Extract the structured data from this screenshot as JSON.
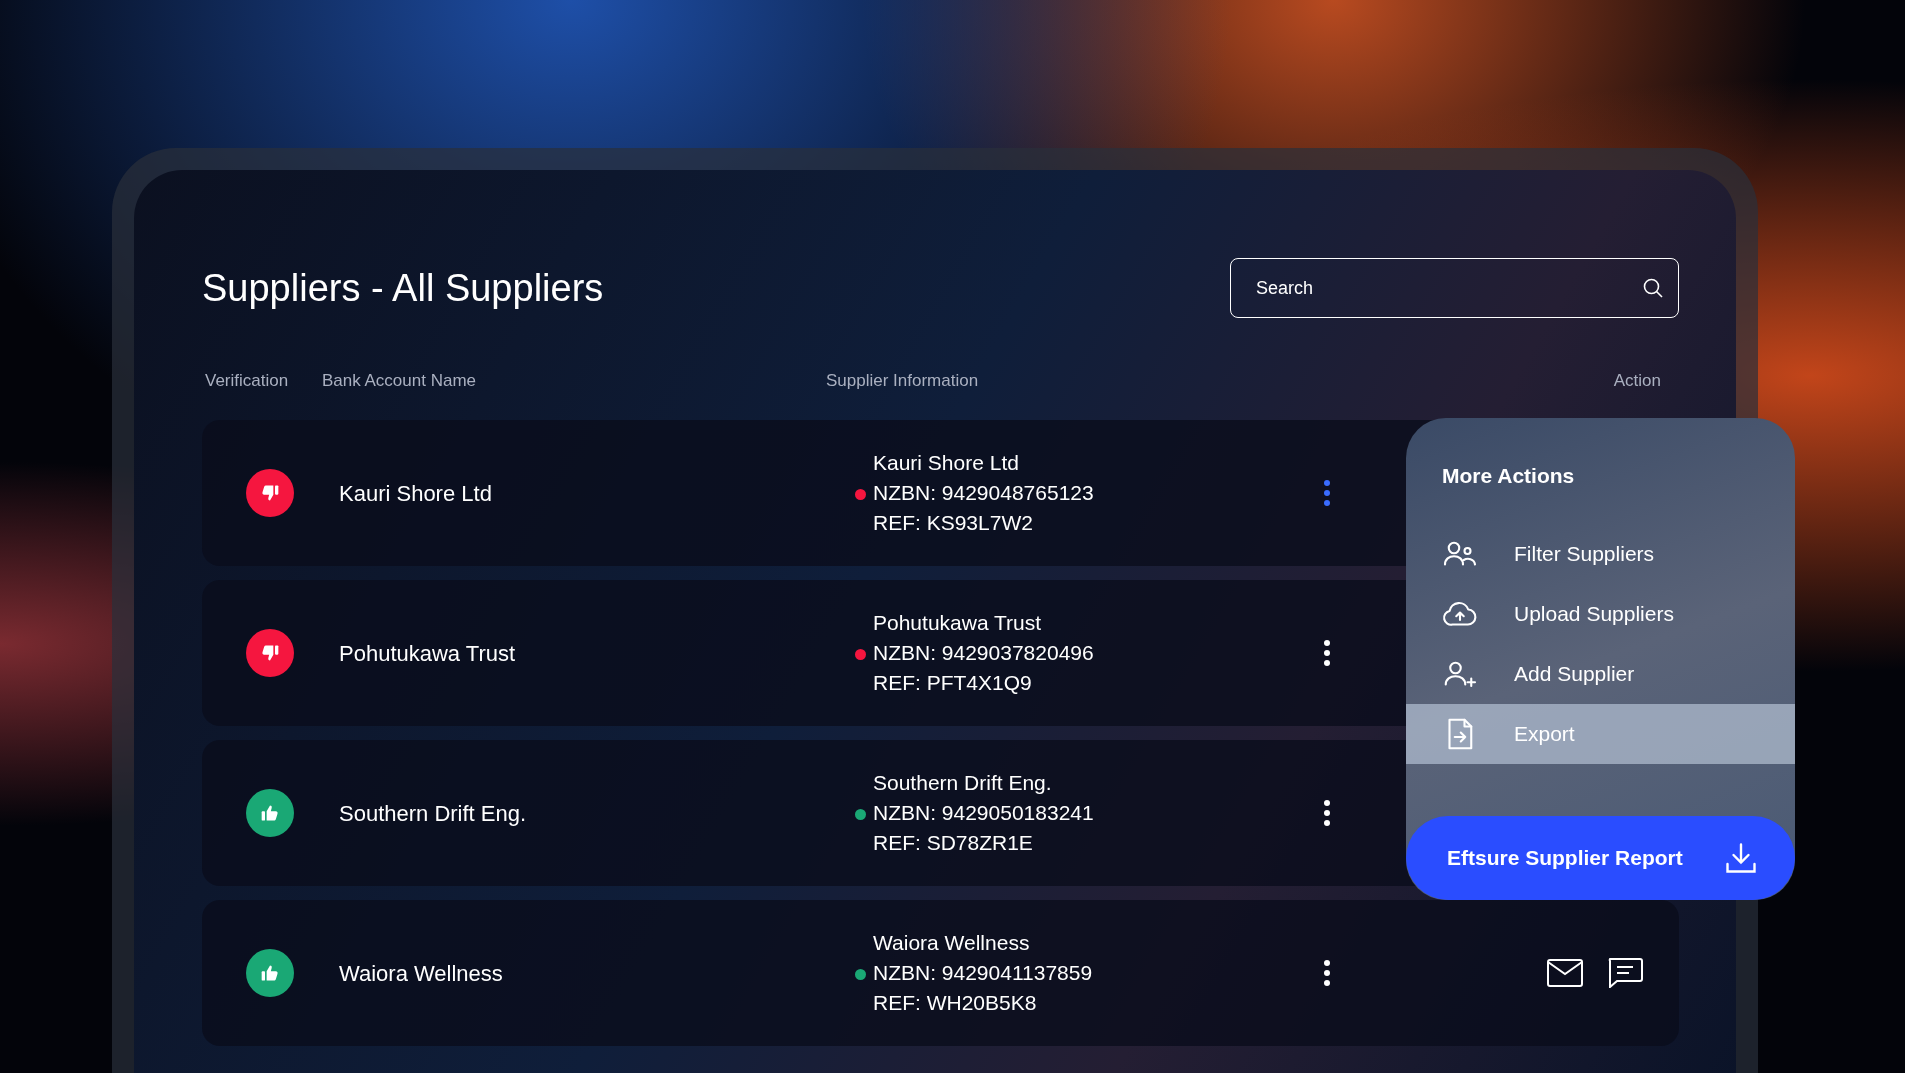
{
  "title": "Suppliers - All Suppliers",
  "search": {
    "placeholder": "Search"
  },
  "columns": [
    "Verification",
    "Bank Account Name",
    "Supplier Information",
    "Action"
  ],
  "rows": [
    {
      "verified": false,
      "name": "Kauri Shore Ltd",
      "info_name": "Kauri Shore Ltd",
      "nzbn": "NZBN: 9429048765123",
      "ref": "REF: KS93L7W2",
      "selected": true
    },
    {
      "verified": false,
      "name": "Pohutukawa Trust",
      "info_name": "Pohutukawa Trust",
      "nzbn": "NZBN: 9429037820496",
      "ref": "REF: PFT4X1Q9",
      "selected": false
    },
    {
      "verified": true,
      "name": "Southern Drift Eng.",
      "info_name": "Southern Drift Eng.",
      "nzbn": "NZBN: 9429050183241",
      "ref": "REF: SD78ZR1E",
      "selected": false
    },
    {
      "verified": true,
      "name": "Waiora Wellness",
      "info_name": "Waiora Wellness",
      "nzbn": "NZBN: 9429041137859",
      "ref": "REF: WH20B5K8",
      "selected": false,
      "show_actions": true
    }
  ],
  "menu": {
    "title": "More Actions",
    "items": [
      {
        "kind": "filter",
        "label": "Filter Suppliers",
        "selected": false
      },
      {
        "kind": "upload",
        "label": "Upload Suppliers",
        "selected": false
      },
      {
        "kind": "add",
        "label": "Add Supplier",
        "selected": false
      },
      {
        "kind": "export",
        "label": "Export",
        "selected": true
      }
    ],
    "report_button": "Eftsure Supplier Report"
  }
}
